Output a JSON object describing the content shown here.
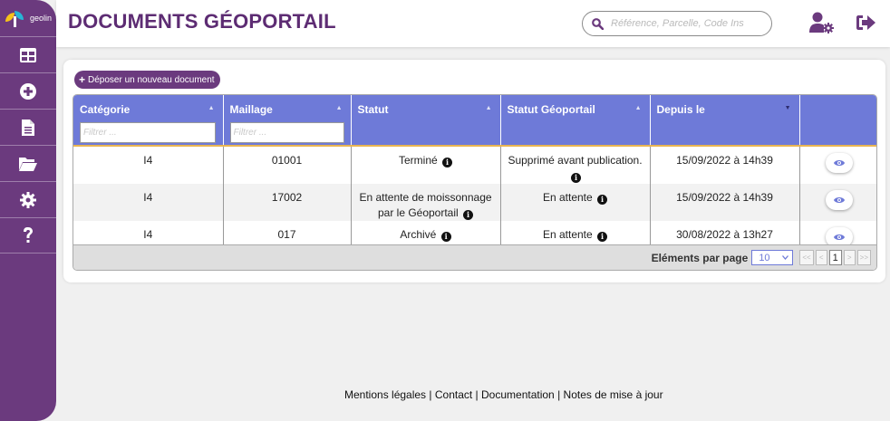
{
  "app": {
    "logo_text": "geolin"
  },
  "sidebar": {
    "items": [
      {
        "icon": "table-icon"
      },
      {
        "icon": "plus-circle-icon"
      },
      {
        "icon": "document-icon"
      },
      {
        "icon": "folder-open-icon"
      },
      {
        "icon": "gear-icon"
      },
      {
        "icon": "question-icon"
      }
    ]
  },
  "header": {
    "title": "DOCUMENTS GÉOPORTAIL",
    "search_placeholder": "Référence, Parcelle, Code Ins",
    "icons": [
      "search-icon",
      "user-settings-icon",
      "logout-icon"
    ]
  },
  "main": {
    "upload_button": "Déposer un nouveau document",
    "table": {
      "columns": [
        {
          "label": "Catégorie",
          "filter_placeholder": "Filtrer ...",
          "sort": "▲"
        },
        {
          "label": "Maillage",
          "filter_placeholder": "Filtrer ...",
          "sort": "▲"
        },
        {
          "label": "Statut",
          "sort": "▲"
        },
        {
          "label": "Statut Géoportail",
          "sort": "▲"
        },
        {
          "label": "Depuis le",
          "sort": "▼"
        },
        {
          "label": ""
        }
      ],
      "rows": [
        {
          "categorie": "I4",
          "maillage": "01001",
          "statut": "Terminé",
          "statut_geoportail": "Supprimé avant publication.",
          "depuis_le": "15/09/2022 à 14h39"
        },
        {
          "categorie": "I4",
          "maillage": "17002",
          "statut": "En attente de moissonnage par le Géoportail",
          "statut_geoportail": "En attente",
          "depuis_le": "15/09/2022 à 14h39"
        },
        {
          "categorie": "I4",
          "maillage": "017",
          "statut": "Archivé",
          "statut_geoportail": "En attente",
          "depuis_le": "30/08/2022 à 13h27"
        }
      ]
    },
    "pager": {
      "label": "Eléments par page",
      "page_size": "10",
      "first": "<<",
      "prev": "<",
      "current": "1",
      "next": ">",
      "last": ">>"
    }
  },
  "footer": {
    "links": [
      "Mentions légales",
      "Contact",
      "Documentation",
      "Notes de mise à jour"
    ],
    "separator": " | "
  },
  "colors": {
    "brand": "#6b3a7e",
    "title": "#5d2c73",
    "table_header": "#6e7ad8",
    "accent_line": "#e9b552",
    "eye": "#6e7ad8"
  }
}
